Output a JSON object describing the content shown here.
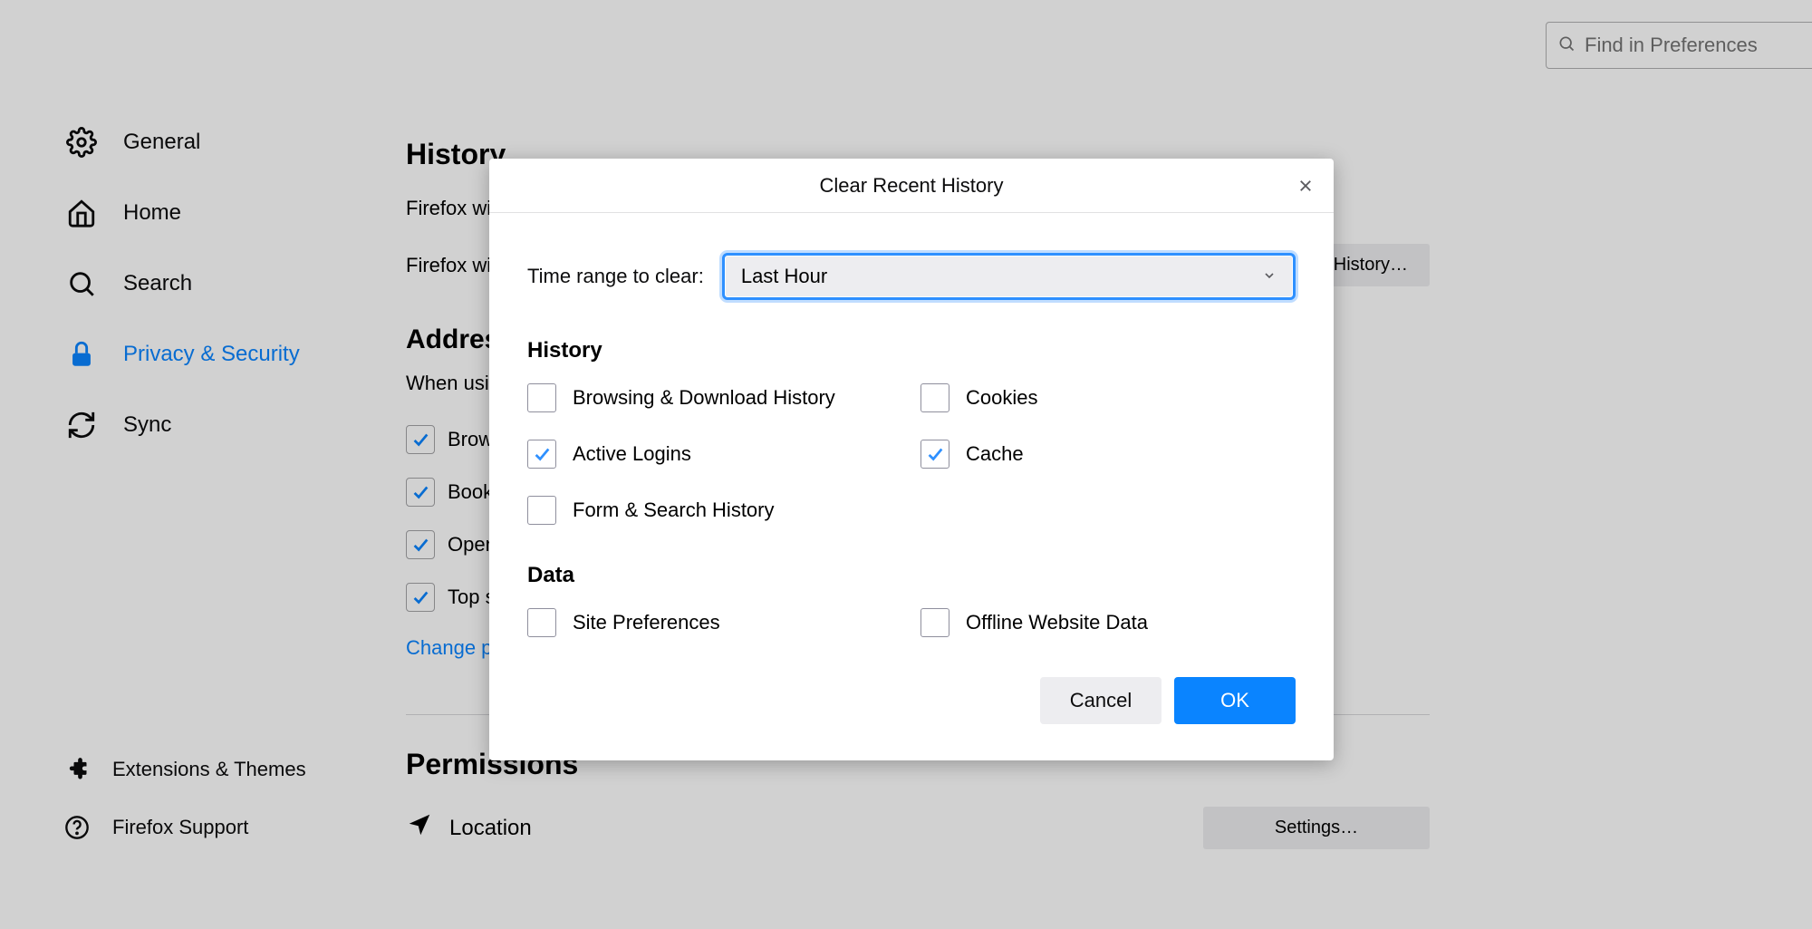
{
  "search": {
    "placeholder": "Find in Preferences"
  },
  "sidebar": {
    "items": [
      {
        "label": "General"
      },
      {
        "label": "Home"
      },
      {
        "label": "Search"
      },
      {
        "label": "Privacy & Security"
      },
      {
        "label": "Sync"
      }
    ],
    "bottom": [
      {
        "label": "Extensions & Themes"
      },
      {
        "label": "Firefox Support"
      }
    ]
  },
  "main": {
    "history_heading": "History",
    "firefox_will": "Firefox will",
    "firefox_will_remember": "Firefox will remember your browsing, download, form and search history.",
    "clear_history_btn": "Clear History…",
    "addressbar_heading": "Address Bar",
    "addressbar_sub": "When using the address bar, suggest",
    "chk_browsing": "Browsing history",
    "chk_bookmarks": "Bookmarks",
    "chk_opentabs": "Open tabs",
    "chk_topsites": "Top sites",
    "change_link": "Change preferences for search engine suggestions",
    "permissions_heading": "Permissions",
    "location_label": "Location",
    "settings_btn": "Settings…"
  },
  "dialog": {
    "title": "Clear Recent History",
    "time_label": "Time range to clear:",
    "time_value": "Last Hour",
    "sect_history": "History",
    "opt_browsing": "Browsing & Download History",
    "opt_cookies": "Cookies",
    "opt_active_logins": "Active Logins",
    "opt_cache": "Cache",
    "opt_form": "Form & Search History",
    "sect_data": "Data",
    "opt_site_prefs": "Site Preferences",
    "opt_offline": "Offline Website Data",
    "cancel": "Cancel",
    "ok": "OK",
    "checked": {
      "browsing": false,
      "cookies": false,
      "active_logins": true,
      "cache": true,
      "form": false,
      "site_prefs": false,
      "offline": false
    }
  }
}
